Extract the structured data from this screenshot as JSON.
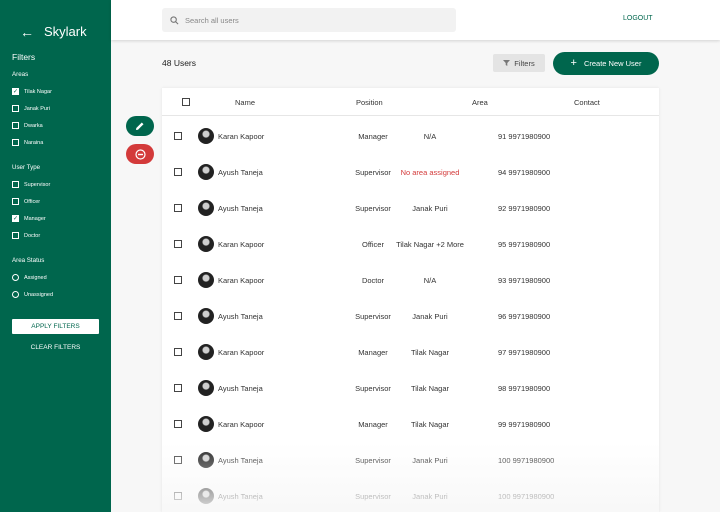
{
  "sidebar": {
    "brand": "Skylark",
    "filters_title": "Filters",
    "areas": {
      "title": "Areas",
      "options": [
        {
          "label": "Tilak Nagar",
          "checked": true
        },
        {
          "label": "Janak Puri",
          "checked": false
        },
        {
          "label": "Dwarka",
          "checked": false
        },
        {
          "label": "Naraina",
          "checked": false
        }
      ]
    },
    "user_type": {
      "title": "User Type",
      "options": [
        {
          "label": "Supervisor",
          "checked": false
        },
        {
          "label": "Officer",
          "checked": false
        },
        {
          "label": "Manager",
          "checked": true
        },
        {
          "label": "Doctor",
          "checked": false
        }
      ]
    },
    "area_status": {
      "title": "Area Status",
      "options": [
        {
          "label": "Assigned"
        },
        {
          "label": "Unassigned"
        }
      ]
    },
    "apply_label": "APPLY FILTERS",
    "clear_label": "CLEAR FILTERS"
  },
  "topbar": {
    "search_placeholder": "Search all users",
    "logout_label": "LOGOUT"
  },
  "toolbar": {
    "users_count": "48 Users",
    "filters_label": "Filters",
    "create_label": "Create New User"
  },
  "colors": {
    "primary": "#00664d",
    "danger": "#d33a3a"
  },
  "table": {
    "headers": [
      "Name",
      "Position",
      "Area",
      "Contact"
    ],
    "rows": [
      {
        "name": "Karan Kapoor",
        "position": "Manager",
        "area": "N/A",
        "contact": "91 9971980900"
      },
      {
        "name": "Ayush Taneja",
        "position": "Supervisor",
        "area": "No area assigned",
        "contact": "94 9971980900"
      },
      {
        "name": "Ayush Taneja",
        "position": "Supervisor",
        "area": "Janak Puri",
        "contact": "92 9971980900"
      },
      {
        "name": "Karan Kapoor",
        "position": "Officer",
        "area": "Tilak Nagar +2 More",
        "contact": "95 9971980900"
      },
      {
        "name": "Karan Kapoor",
        "position": "Doctor",
        "area": "N/A",
        "contact": "93 9971980900"
      },
      {
        "name": "Ayush Taneja",
        "position": "Supervisor",
        "area": "Janak Puri",
        "contact": "96 9971980900"
      },
      {
        "name": "Karan Kapoor",
        "position": "Manager",
        "area": "Tilak Nagar",
        "contact": "97 9971980900"
      },
      {
        "name": "Ayush Taneja",
        "position": "Supervisor",
        "area": "Tilak Nagar",
        "contact": "98 9971980900"
      },
      {
        "name": "Karan Kapoor",
        "position": "Manager",
        "area": "Tilak Nagar",
        "contact": "99 9971980900"
      },
      {
        "name": "Ayush Taneja",
        "position": "Supervisor",
        "area": "Janak Puri",
        "contact": "100 9971980900"
      },
      {
        "name": "Ayush Taneja",
        "position": "Supervisor",
        "area": "Janak Puri",
        "contact": "100 9971980900"
      }
    ]
  }
}
